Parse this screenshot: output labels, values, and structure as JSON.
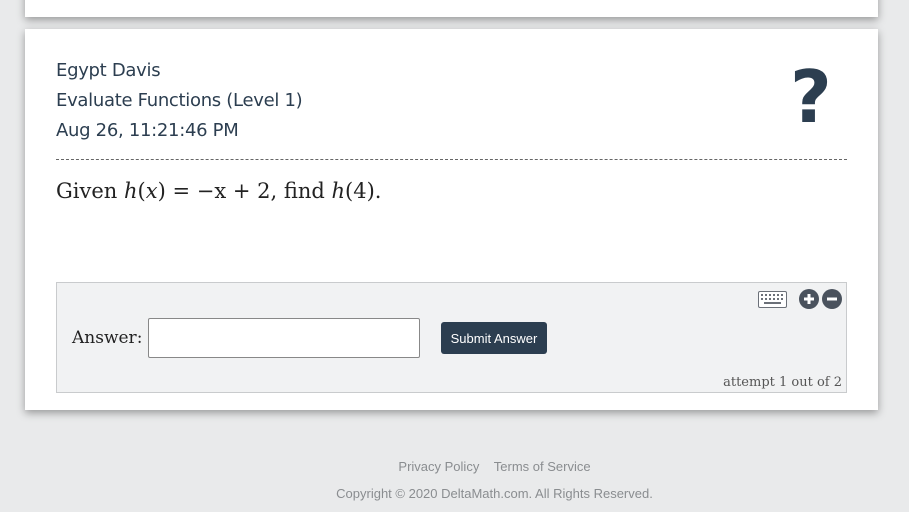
{
  "header": {
    "student_name": "Egypt Davis",
    "problem_title": "Evaluate Functions (Level 1)",
    "timestamp": "Aug 26, 11:21:46 PM",
    "help_symbol": "?"
  },
  "question": {
    "prefix": "Given",
    "func": "h",
    "var": "x",
    "expression_rhs": "= −x + 2,",
    "find_text": "find",
    "find_arg": "(4)."
  },
  "answer": {
    "label": "Answer:",
    "input_value": "",
    "input_placeholder": "",
    "submit_label": "Submit Answer",
    "attempt_text": "attempt 1 out of 2",
    "icons": [
      "keyboard-icon",
      "plus-circle-icon",
      "minus-circle-icon"
    ]
  },
  "footer": {
    "privacy_label": "Privacy Policy",
    "terms_label": "Terms of Service",
    "copyright": "Copyright © 2020 DeltaMath.com. All Rights Reserved."
  },
  "colors": {
    "accent": "#2c3e50",
    "background": "#e9eaeb",
    "answer_panel": "#f1f2f3"
  }
}
